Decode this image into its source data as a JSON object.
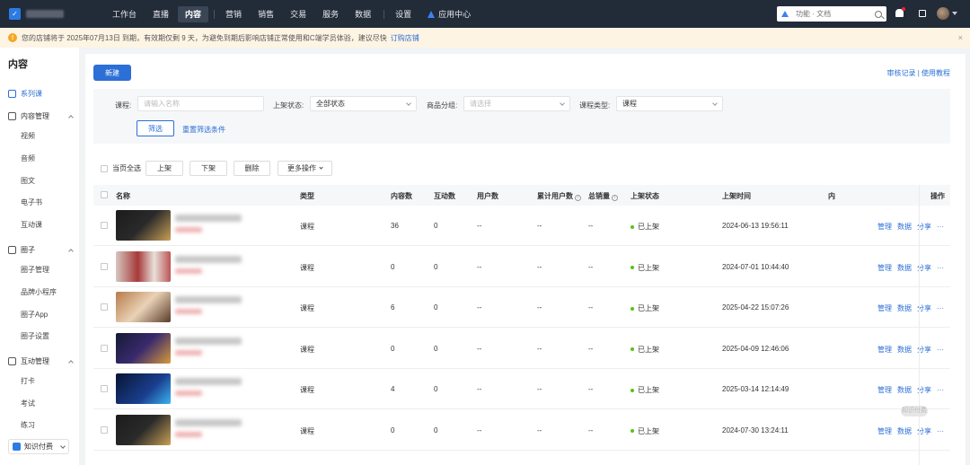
{
  "topbar": {
    "nav": [
      "工作台",
      "直播",
      "内容",
      "营销",
      "销售",
      "交易",
      "服务",
      "数据",
      "设置"
    ],
    "active_nav": "内容",
    "app_center": "应用中心",
    "search_placeholder": "功能 · 文档"
  },
  "notice": {
    "text": "您的店铺将于 2025年07月13日 到期，有效期仅剩 9 天，为避免到期后影响店铺正常使用和C端学员体验，建议尽快",
    "link": "订购店铺",
    "close": "×"
  },
  "sidebar": {
    "title": "内容",
    "active": "系列课",
    "groups": [
      {
        "label": "内容管理",
        "items": [
          "视频",
          "音频",
          "图文",
          "电子书",
          "互动课"
        ]
      },
      {
        "label": "圈子",
        "items": [
          "圈子管理",
          "品牌小程序",
          "圈子App",
          "圈子设置"
        ]
      },
      {
        "label": "互动管理",
        "items": [
          "打卡",
          "考试",
          "练习"
        ]
      }
    ],
    "bottom": "知识付费"
  },
  "main": {
    "new_button": "新建",
    "links": [
      "审核记录",
      "使用教程"
    ],
    "filter": {
      "course_label": "课程:",
      "course_placeholder": "请输入名称",
      "status_label": "上架状态:",
      "status_value": "全部状态",
      "group_label": "商品分组:",
      "group_placeholder": "请选择",
      "type_label": "课程类型:",
      "type_value": "课程",
      "filter_button": "筛选",
      "reset_link": "重置筛选条件"
    },
    "bulk": {
      "select_all": "当页全选",
      "up": "上架",
      "down": "下架",
      "delete": "删除",
      "more": "更多操作"
    },
    "columns": [
      "名称",
      "类型",
      "内容数",
      "互动数",
      "用户数",
      "累计用户数",
      "总销量",
      "上架状态",
      "上架时间",
      "内",
      "操作"
    ],
    "rows": [
      {
        "type": "课程",
        "content": "36",
        "interact": "0",
        "users": "--",
        "total_users": "--",
        "sales": "--",
        "status": "已上架",
        "time": "2024-06-13 19:56:11"
      },
      {
        "type": "课程",
        "content": "0",
        "interact": "0",
        "users": "--",
        "total_users": "--",
        "sales": "--",
        "status": "已上架",
        "time": "2024-07-01 10:44:40"
      },
      {
        "type": "课程",
        "content": "6",
        "interact": "0",
        "users": "--",
        "total_users": "--",
        "sales": "--",
        "status": "已上架",
        "time": "2025-04-22 15:07:26"
      },
      {
        "type": "课程",
        "content": "0",
        "interact": "0",
        "users": "--",
        "total_users": "--",
        "sales": "--",
        "status": "已上架",
        "time": "2025-04-09 12:46:06"
      },
      {
        "type": "课程",
        "content": "4",
        "interact": "0",
        "users": "--",
        "total_users": "--",
        "sales": "--",
        "status": "已上架",
        "time": "2025-03-14 12:14:49"
      },
      {
        "type": "课程",
        "content": "0",
        "interact": "0",
        "users": "--",
        "total_users": "--",
        "sales": "--",
        "status": "已上架",
        "time": "2024-07-30 13:24:11"
      }
    ],
    "ops": [
      "管理",
      "数据",
      "分享",
      "···"
    ],
    "watermark": "知识付费"
  },
  "colors": {
    "primary": "#2c6fd6",
    "topbar": "#222b38",
    "notice_bg": "#fdf4e3",
    "status_dot": "#52c41a"
  }
}
